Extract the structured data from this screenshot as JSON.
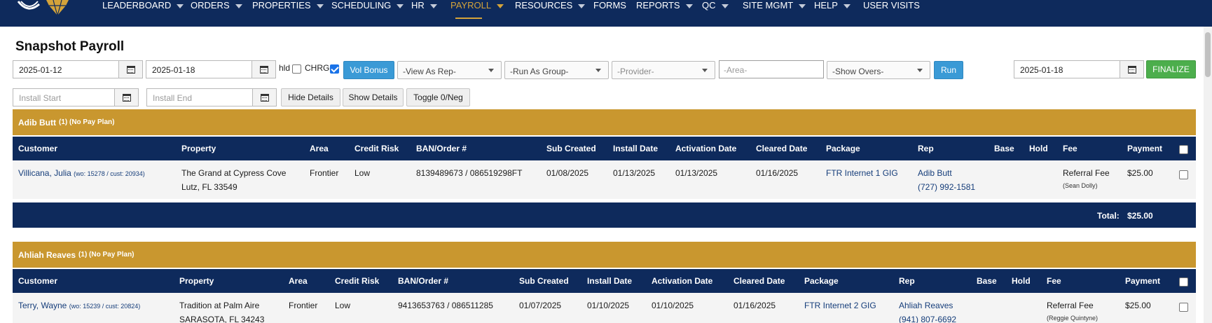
{
  "nav": {
    "items": [
      {
        "label": "LEADERBOARD",
        "chevron": true
      },
      {
        "label": "ORDERS",
        "chevron": true
      },
      {
        "label": "PROPERTIES",
        "chevron": true
      },
      {
        "label": "SCHEDULING",
        "chevron": true
      },
      {
        "label": "HR",
        "chevron": true
      },
      {
        "label": "PAYROLL",
        "chevron": true,
        "active": true
      },
      {
        "label": "RESOURCES",
        "chevron": true
      },
      {
        "label": "FORMS",
        "chevron": false
      },
      {
        "label": "REPORTS",
        "chevron": true
      },
      {
        "label": "QC",
        "chevron": true
      },
      {
        "label": "SITE MGMT",
        "chevron": true
      },
      {
        "label": "HELP",
        "chevron": true
      },
      {
        "label": "USER VISITS",
        "chevron": false
      }
    ]
  },
  "page": {
    "title": "Snapshot Payroll"
  },
  "filters": {
    "start_date": "2025-01-12",
    "end_date": "2025-01-18",
    "hld_label": "hld",
    "hld_checked": false,
    "chrg_label": "CHRG",
    "chrg_checked": true,
    "vol_bonus": "Vol Bonus",
    "view_as_rep": "-View As Rep-",
    "run_as_group": "-Run As Group-",
    "provider": "-Provider-",
    "area_placeholder": "-Area-",
    "show_overs": "-Show Overs-",
    "run": "Run",
    "finalize_date": "2025-01-18",
    "finalize": "FINALIZE",
    "install_start_placeholder": "Install Start",
    "install_end_placeholder": "Install End",
    "hide_details": "Hide Details",
    "show_details": "Show Details",
    "toggle": "Toggle 0/Neg"
  },
  "columns": [
    "Customer",
    "Property",
    "Area",
    "Credit Risk",
    "BAN/Order #",
    "Sub Created",
    "Install Date",
    "Activation Date",
    "Cleared Date",
    "Package",
    "Rep",
    "Base",
    "Hold",
    "Fee",
    "Payment"
  ],
  "groups": [
    {
      "name": "Adib Butt",
      "count": "(1) (No Pay Plan)",
      "rows": [
        {
          "customer": "Villicana, Julia",
          "customer_meta": "(wo: 15278 / cust: 20934)",
          "property_line1": "The Grand at Cypress Cove",
          "property_line2": "Lutz, FL 33549",
          "area": "Frontier",
          "credit_risk": "Low",
          "ban_order": "8139489673 / 086519298FT",
          "sub_created": "01/08/2025",
          "install_date": "01/13/2025",
          "activation_date": "01/13/2025",
          "cleared_date": "01/16/2025",
          "package": "FTR Internet 1 GIG",
          "rep_name": "Adib Butt",
          "rep_phone": "(727) 992-1581",
          "base": "",
          "hold": "",
          "fee": "Referral Fee",
          "fee_sub": "(Sean Dolly)",
          "payment": "$25.00"
        }
      ],
      "total_label": "Total:",
      "total_value": "$25.00"
    },
    {
      "name": "Ahliah Reaves",
      "count": "(1) (No Pay Plan)",
      "rows": [
        {
          "customer": "Terry, Wayne",
          "customer_meta": "(wo: 15239 / cust: 20824)",
          "property_line1": "Tradition at Palm Aire",
          "property_line2": "SARASOTA, FL 34243",
          "area": "Frontier",
          "credit_risk": "Low",
          "ban_order": "9413653763 / 086511285",
          "sub_created": "01/07/2025",
          "install_date": "01/10/2025",
          "activation_date": "01/10/2025",
          "cleared_date": "01/16/2025",
          "package": "FTR Internet 2 GIG",
          "rep_name": "Ahliah Reaves",
          "rep_phone": "(941) 807-6692",
          "base": "",
          "hold": "",
          "fee": "Referral Fee",
          "fee_sub": "(Reggie Quintyne)",
          "payment": "$25.00"
        }
      ]
    }
  ],
  "colors": {
    "nav": "#0e2a5c",
    "gold": "#c9972f",
    "accent_blue": "#3a9ad6",
    "finalize_green": "#4cae4c"
  }
}
